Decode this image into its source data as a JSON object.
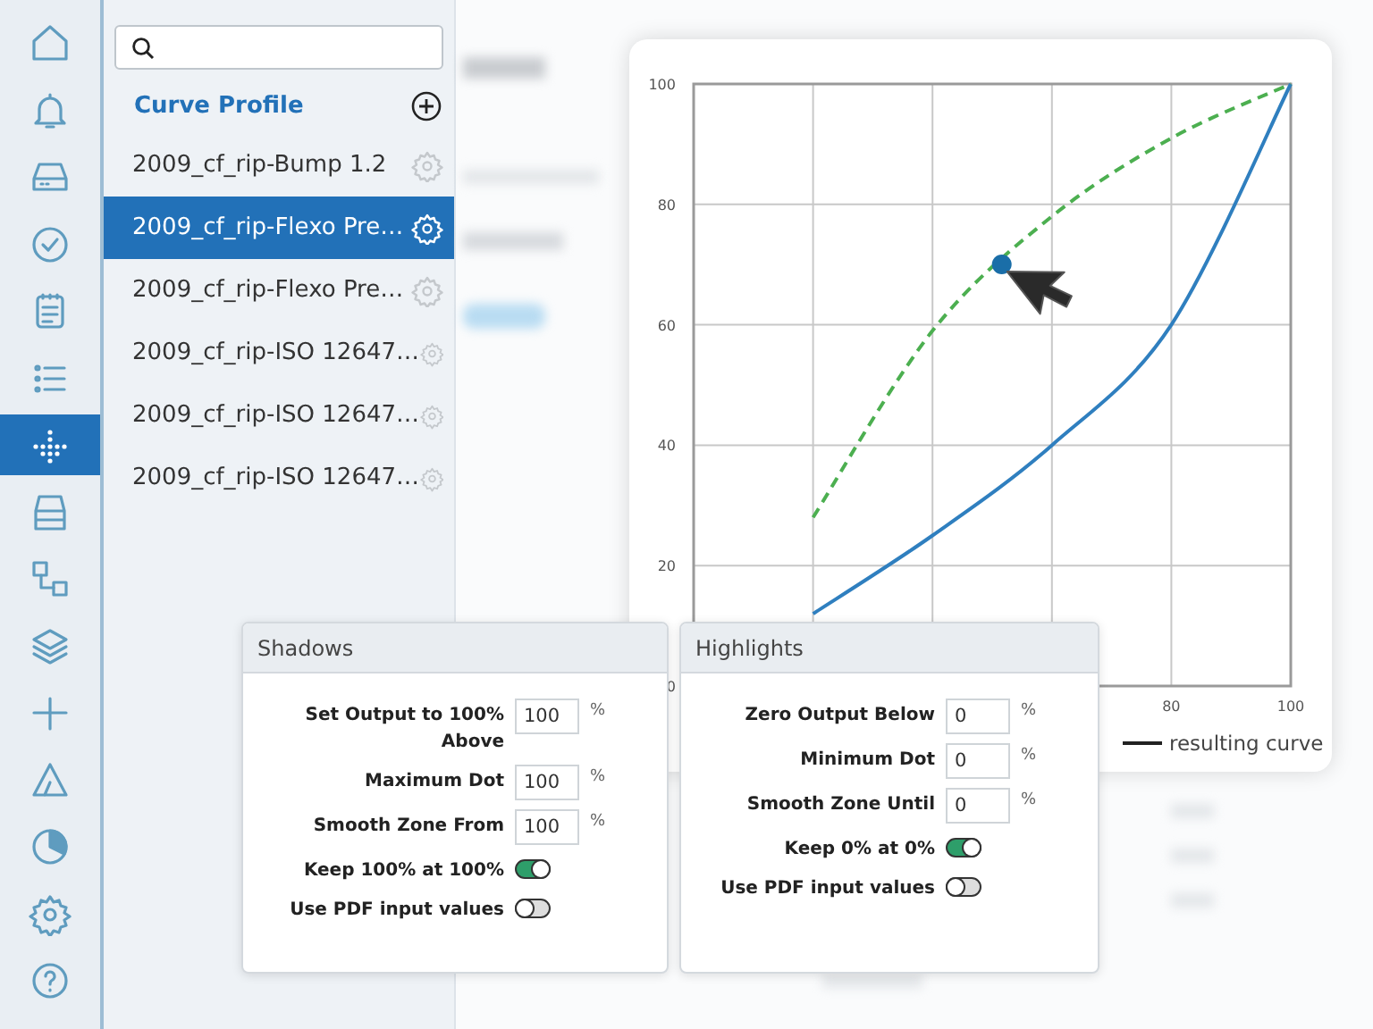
{
  "nav_items": [
    {
      "kind": "home",
      "selected": false
    },
    {
      "kind": "bell",
      "selected": false
    },
    {
      "kind": "drive",
      "selected": false
    },
    {
      "kind": "check",
      "selected": false
    },
    {
      "kind": "clipboard",
      "selected": false
    },
    {
      "kind": "list",
      "selected": false
    },
    {
      "kind": "dots",
      "selected": true
    },
    {
      "kind": "tray",
      "selected": false
    },
    {
      "kind": "nodes",
      "selected": false
    },
    {
      "kind": "layers",
      "selected": false
    },
    {
      "kind": "cross",
      "selected": false
    },
    {
      "kind": "triangle",
      "selected": false
    },
    {
      "kind": "pie",
      "selected": false
    },
    {
      "kind": "gear",
      "selected": false
    },
    {
      "kind": "help",
      "selected": false
    }
  ],
  "profile_list": {
    "title": "Curve Profile",
    "items": [
      {
        "label": "2009_cf_rip-Bump 1.2",
        "selected": false
      },
      {
        "label": "2009_cf_rip-Flexo Pre…",
        "selected": true
      },
      {
        "label": "2009_cf_rip-Flexo Pre…",
        "selected": false
      },
      {
        "label": "2009_cf_rip-ISO 12647…",
        "selected": false
      },
      {
        "label": "2009_cf_rip-ISO 12647…",
        "selected": false
      },
      {
        "label": "2009_cf_rip-ISO 12647…",
        "selected": false
      }
    ]
  },
  "chart": {
    "chart_data": {
      "type": "line",
      "x": [
        20,
        40,
        60,
        80,
        100
      ],
      "series": [
        {
          "name": "resulting curve",
          "color": "#2f7fbf",
          "values": [
            12,
            25,
            40,
            60,
            100
          ]
        },
        {
          "color": "#4caf50",
          "line_style": "dashed",
          "values": [
            28,
            59,
            78,
            91,
            100
          ]
        }
      ],
      "grid": true,
      "xlim": [
        0,
        100
      ],
      "ylim": [
        0,
        100
      ],
      "xticks": [
        80,
        100
      ],
      "yticks": [
        0,
        20,
        40,
        60,
        80,
        100
      ]
    }
  },
  "panels": [
    {
      "title": "Shadows",
      "rows": [
        {
          "kind": "number",
          "label": "Set Output to 100% Above",
          "value": "100",
          "unit": "%"
        },
        {
          "kind": "number",
          "label": "Maximum Dot",
          "value": "100",
          "unit": "%"
        },
        {
          "kind": "number",
          "label": "Smooth Zone From",
          "value": "100",
          "unit": "%"
        },
        {
          "kind": "toggle",
          "label": "Keep 100% at 100%",
          "on": true
        },
        {
          "kind": "toggle",
          "label": "Use PDF input values",
          "on": false
        }
      ]
    },
    {
      "title": "Highlights",
      "rows": [
        {
          "kind": "number",
          "label": "Zero Output Below",
          "value": "0",
          "unit": "%"
        },
        {
          "kind": "number",
          "label": "Minimum Dot",
          "value": "0",
          "unit": "%"
        },
        {
          "kind": "number",
          "label": "Smooth Zone Until",
          "value": "0",
          "unit": "%"
        },
        {
          "kind": "toggle",
          "label": "Keep 0% at 0%",
          "on": true
        },
        {
          "kind": "toggle",
          "label": "Use PDF input values",
          "on": false
        }
      ]
    }
  ]
}
